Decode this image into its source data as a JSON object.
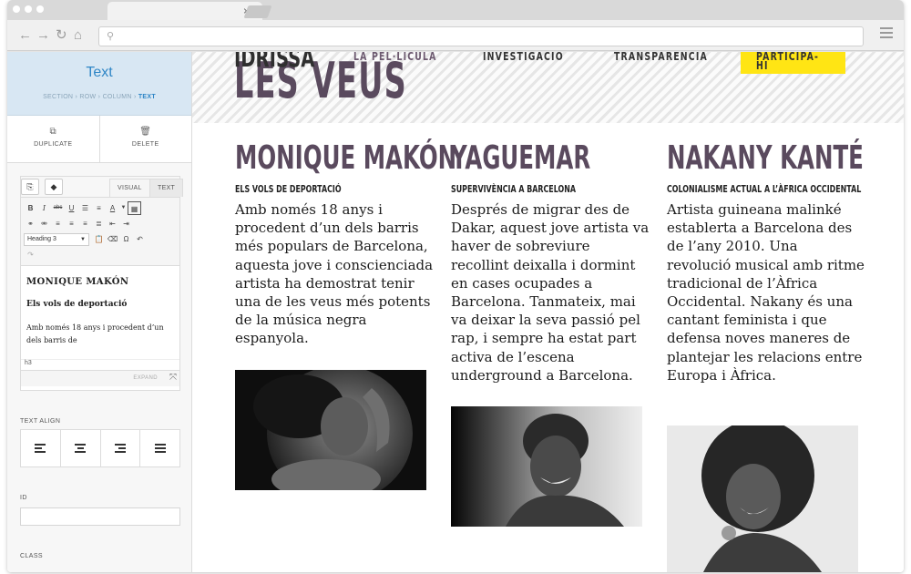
{
  "browser": {
    "tab_close": "×",
    "nav": {
      "back": "←",
      "forward": "→",
      "reload": "↻",
      "home": "⌂"
    },
    "url_icon": "⚲"
  },
  "sidebar": {
    "title": "Text",
    "breadcrumb": [
      "SECTION",
      "ROW",
      "COLUMN",
      "TEXT"
    ],
    "breadcrumb_separator": " › ",
    "actions": [
      {
        "label": "DUPLICATE",
        "icon": "duplicate-icon"
      },
      {
        "label": "DELETE",
        "icon": "trash-icon"
      }
    ],
    "editor": {
      "tabs": [
        "VISUAL",
        "TEXT"
      ],
      "format": "Heading 3",
      "content_heading": "MONIQUE MAKÓN",
      "content_subheading": "Els vols de deportació",
      "content_paragraph": "Amb només 18 anys i procedent d’un dels barris de",
      "status_path": "h3",
      "expand_label": "EXPAND"
    },
    "text_align_label": "TEXT ALIGN",
    "id_label": "ID",
    "class_label": "CLASS",
    "id_value": ""
  },
  "site": {
    "logo": "IDRISSA",
    "nav": [
      "LA PEL·LÍCULA",
      "INVESTIGACIÓ",
      "TRANSPARÈNCIA"
    ],
    "cta": "PARTICIPA-HI",
    "hero_title": "LES VEUS",
    "colors": {
      "accent": "#5a4a5e",
      "cta": "#ffe514"
    },
    "columns": [
      {
        "name": "MONIQUE MAKÓN",
        "subtitle": "ELS VOLS DE DEPORTACIÓ",
        "text": "Amb només 18 anys i procedent d’un dels barris més populars de Barcelona, aquesta jove i conscienciada artista ha demostrat tenir una de les veus més potents de la música negra espanyola."
      },
      {
        "name": "YAGUEMAR",
        "subtitle": "SUPERVIVÈNCIA A BARCELONA",
        "text": "Després de migrar des de Dakar, aquest jove artista va haver de sobreviure recollint deixalla i dormint en cases ocupades a Barcelona. Tanmateix, mai va deixar la seva passió pel rap, i sempre ha estat part activa de l’escena underground a Barcelona."
      },
      {
        "name": "NAKANY KANTÉ",
        "subtitle": "COLONIALISME ACTUAL A L’ÀFRICA OCCIDENTAL",
        "text": "Artista guineana malinké establerta a Barcelona des de l’any 2010. Una revolució musical amb ritme tradicional de l’Àfrica Occidental. Nakany és una cantant feminista i que defensa noves maneres de plantejar les relacions entre Europa i Àfrica."
      }
    ]
  }
}
